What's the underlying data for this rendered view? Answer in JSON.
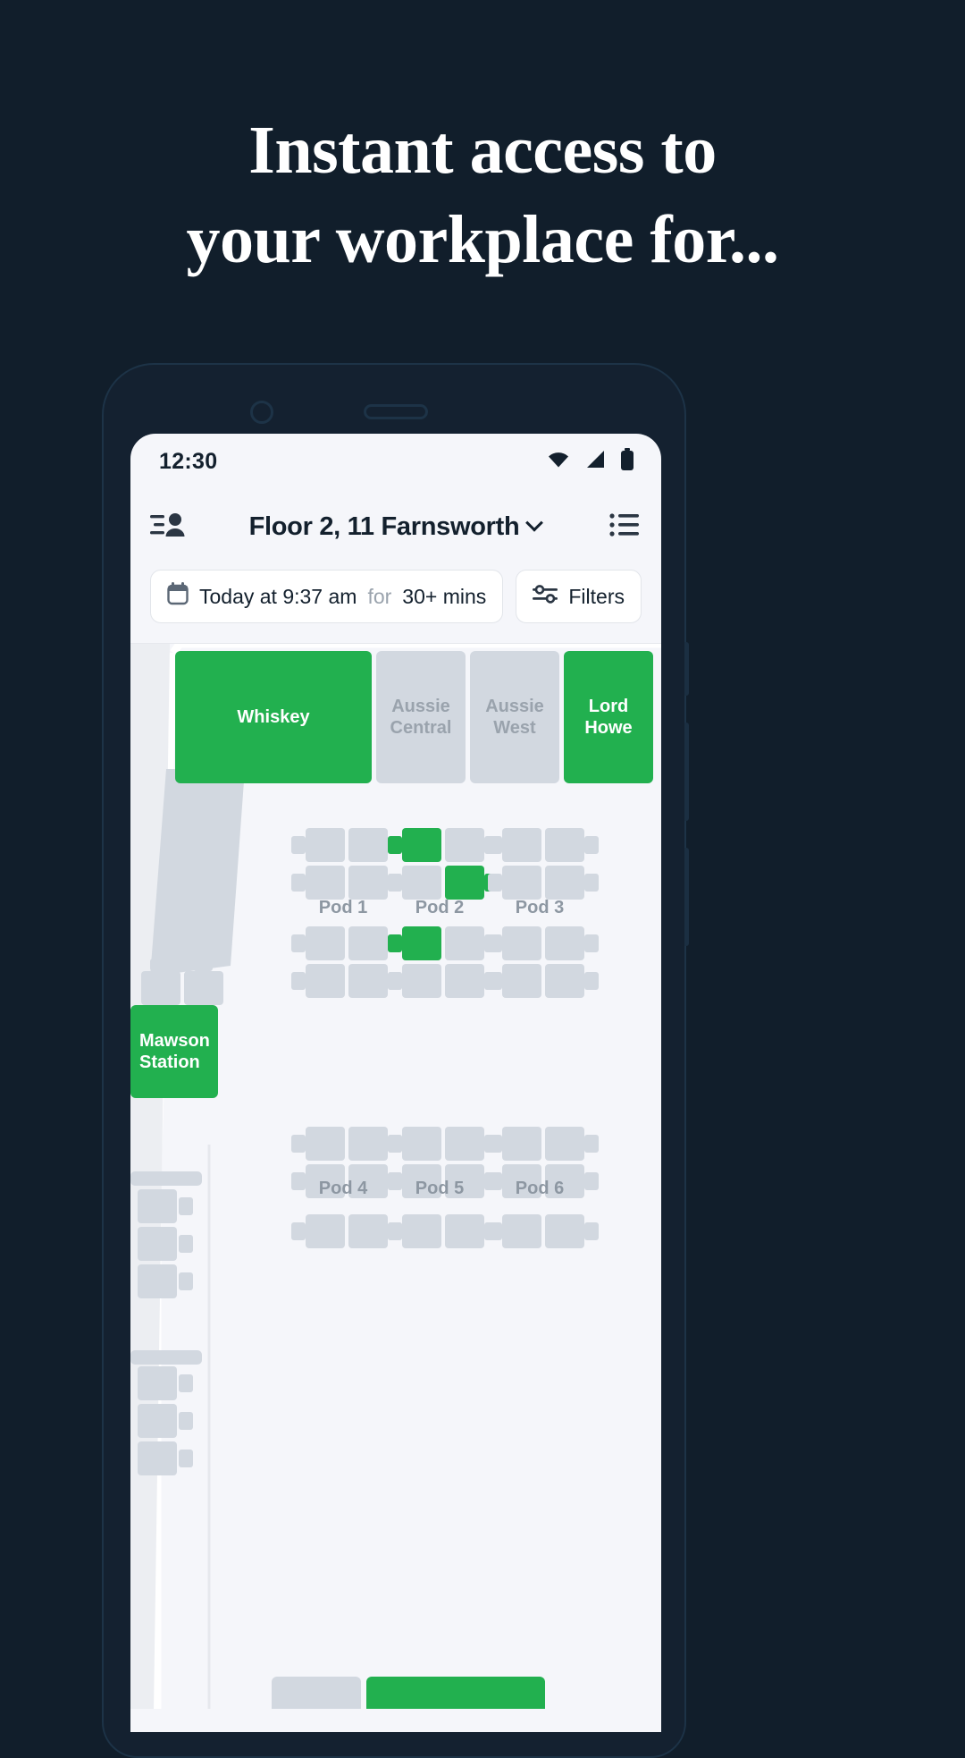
{
  "headline": {
    "line1": "Instant access to",
    "line2": "your workplace for..."
  },
  "colors": {
    "background": "#111e2b",
    "available": "#22b04f",
    "occupied": "#d2d8e0",
    "screen": "#f5f6fa",
    "text": "#13202d",
    "muted": "#9aa3ad"
  },
  "phone": {
    "status_bar": {
      "time": "12:30",
      "icons": [
        "wifi-icon",
        "signal-icon",
        "battery-icon"
      ]
    },
    "app_header": {
      "left_icon": "people-list-icon",
      "title": "Floor 2, 11 Farnsworth",
      "chevron": "chevron-down-icon",
      "right_icon": "list-view-icon"
    },
    "filters": {
      "time_icon": "calendar-icon",
      "time_prefix": "Today at 9:37 am",
      "time_connector": "for",
      "time_duration": "30+ mins",
      "filters_icon": "sliders-icon",
      "filters_label": "Filters"
    },
    "map": {
      "rooms": [
        {
          "name": "Whiskey",
          "status": "available"
        },
        {
          "name": "Aussie Central",
          "status": "occupied"
        },
        {
          "name": "Aussie West",
          "status": "occupied"
        },
        {
          "name": "Lord Howe",
          "status": "available"
        },
        {
          "name": "Mawson Station",
          "status": "available"
        }
      ],
      "pods": [
        {
          "name": "Pod 1",
          "free_desks": 0
        },
        {
          "name": "Pod 2",
          "free_desks": 3
        },
        {
          "name": "Pod 3",
          "free_desks": 0
        },
        {
          "name": "Pod 4",
          "free_desks": 0
        },
        {
          "name": "Pod 5",
          "free_desks": 0
        },
        {
          "name": "Pod 6",
          "free_desks": 0
        }
      ]
    }
  }
}
